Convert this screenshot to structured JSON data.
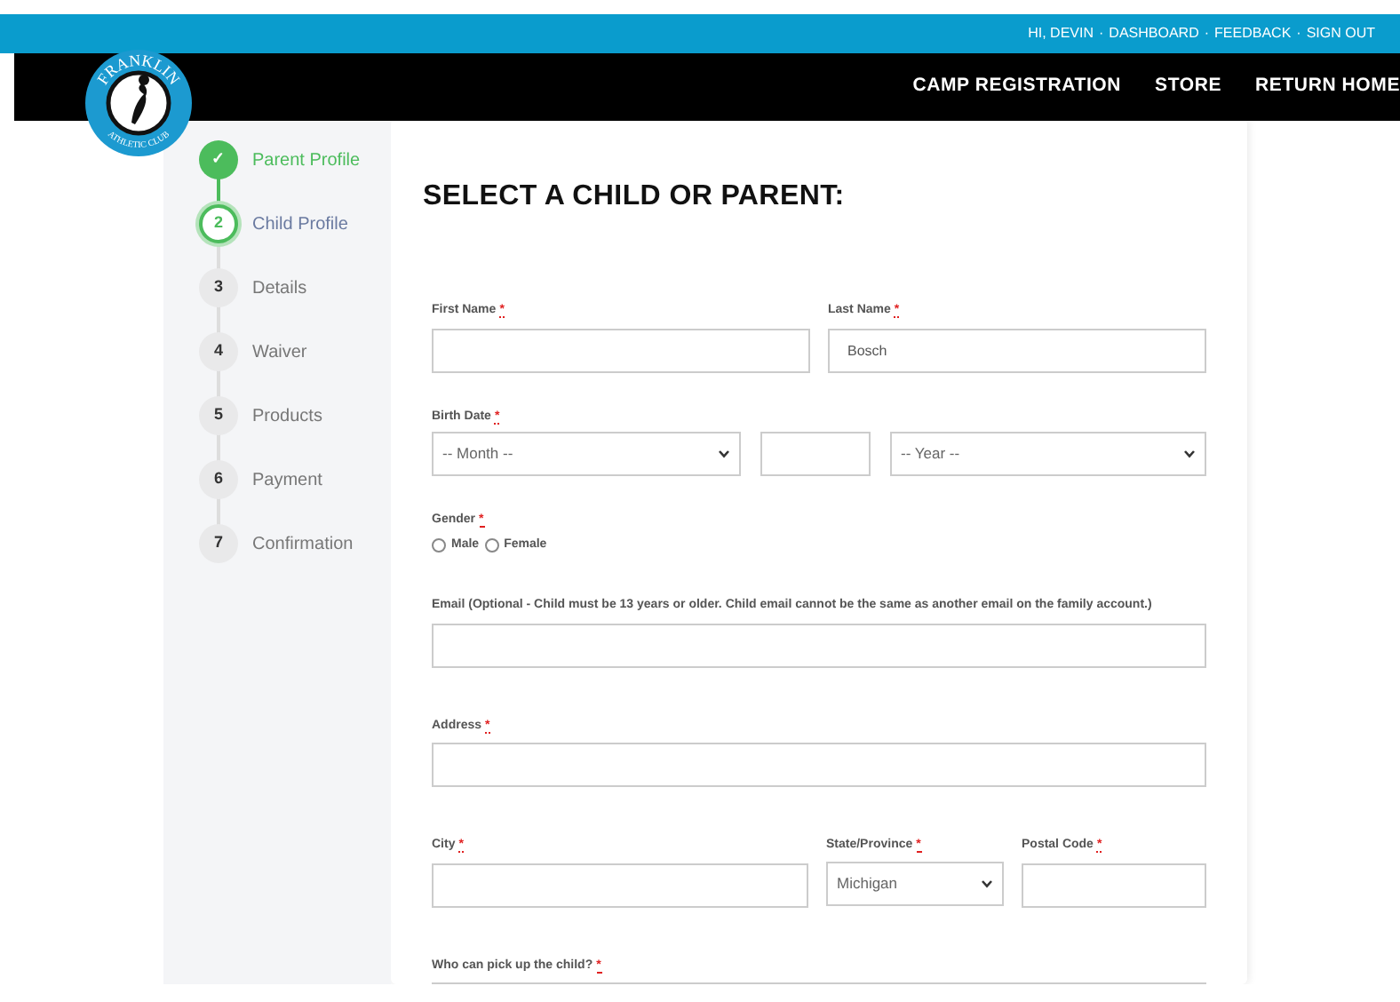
{
  "topbar": {
    "links": [
      "HI, DEVIN",
      "DASHBOARD",
      "FEEDBACK",
      "SIGN OUT"
    ],
    "separator": "·"
  },
  "logo": {
    "top_text": "FRANKLIN",
    "bottom_text": "ATHLETIC CLUB"
  },
  "nav": [
    "CAMP REGISTRATION",
    "STORE",
    "RETURN HOME"
  ],
  "steps": [
    {
      "marker": "✓",
      "label": "Parent Profile",
      "completed": true,
      "selected": false
    },
    {
      "marker": "2",
      "label": "Child Profile",
      "completed": false,
      "selected": true
    },
    {
      "marker": "3",
      "label": "Details",
      "completed": false,
      "selected": false
    },
    {
      "marker": "4",
      "label": "Waiver",
      "completed": false,
      "selected": false
    },
    {
      "marker": "5",
      "label": "Products",
      "completed": false,
      "selected": false
    },
    {
      "marker": "6",
      "label": "Payment",
      "completed": false,
      "selected": false
    },
    {
      "marker": "7",
      "label": "Confirmation",
      "completed": false,
      "selected": false
    }
  ],
  "form": {
    "title": "SELECT A CHILD OR PARENT:",
    "required_mark": "*",
    "rows": [
      {
        "kind": "pair",
        "fields": [
          {
            "label": "First Name",
            "required": true,
            "kind": "text"
          },
          {
            "label": "Last Name",
            "required": true,
            "kind": "text",
            "value": "Bosch"
          }
        ]
      },
      {
        "kind": "date",
        "label": "Birth Date",
        "required": true,
        "fields": [
          {
            "kind": "select",
            "value": "-- Month --"
          },
          {
            "kind": "text"
          },
          {
            "kind": "select",
            "value": "-- Year --"
          }
        ]
      },
      {
        "kind": "radio",
        "label": "Gender",
        "required": true,
        "options": [
          {
            "label": "Male",
            "checked": false
          },
          {
            "label": "Female",
            "checked": false
          }
        ]
      },
      {
        "kind": "single",
        "fields": [
          {
            "label": "Email (Optional - Child must be 13 years or older. Child email cannot be the same as another email on the family account.)",
            "required": false,
            "kind": "text"
          }
        ]
      },
      {
        "kind": "single",
        "fields": [
          {
            "label": "Address",
            "required": true,
            "kind": "text"
          }
        ]
      },
      {
        "kind": "triple",
        "fields": [
          {
            "label": "City",
            "required": true,
            "kind": "text"
          },
          {
            "label": "State/Province",
            "required": true,
            "kind": "select",
            "value": "Michigan"
          },
          {
            "label": "Postal Code",
            "required": true,
            "kind": "text"
          }
        ]
      },
      {
        "kind": "single",
        "fields": [
          {
            "label": "Who can pick up the child?",
            "required": true,
            "kind": "text"
          }
        ]
      }
    ]
  }
}
